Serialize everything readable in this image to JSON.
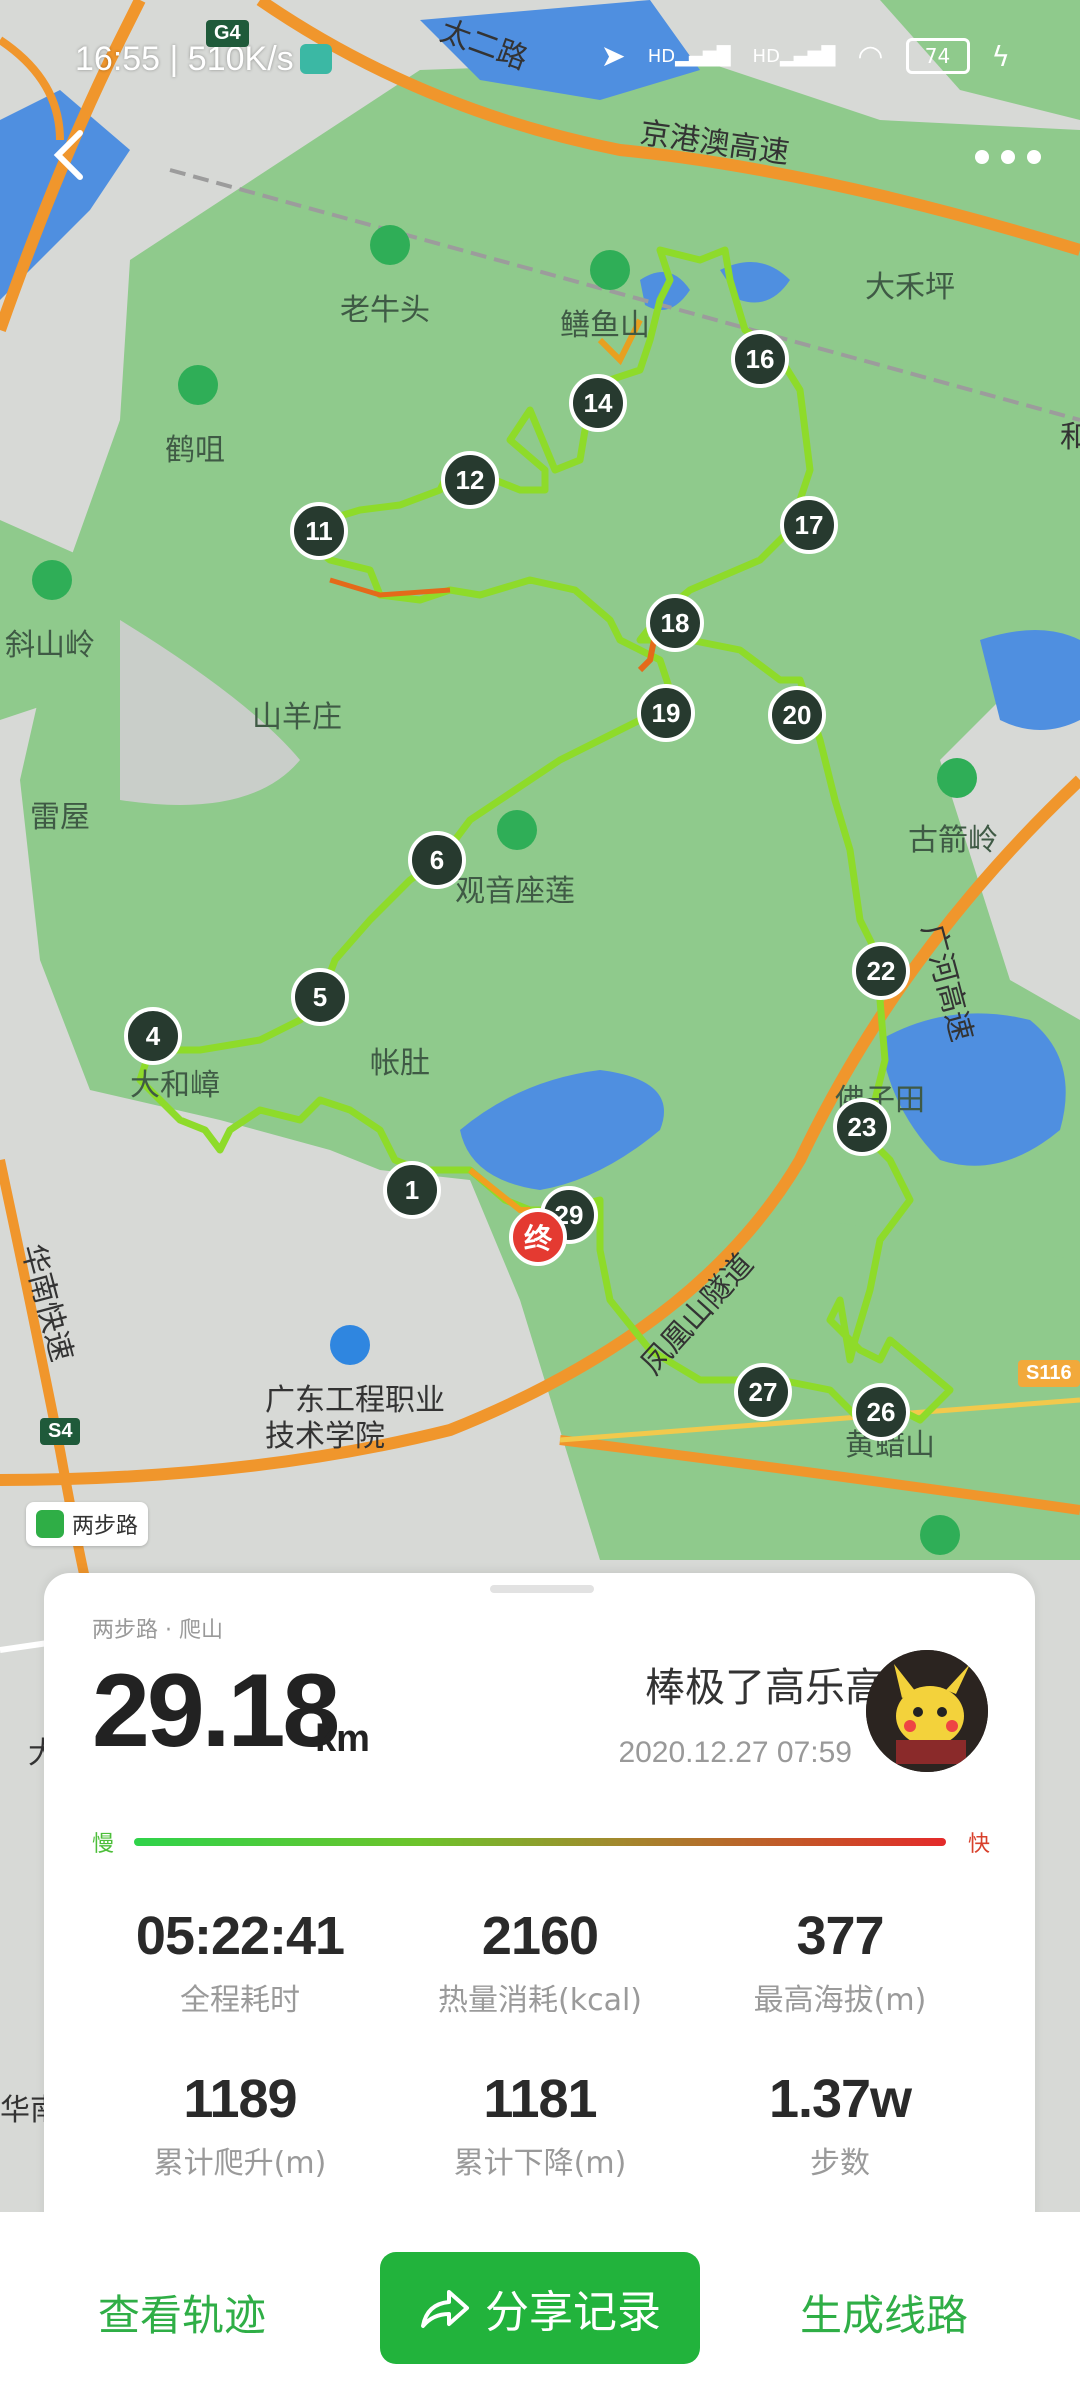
{
  "status_bar": {
    "time_speed": "16:55 | 510K/s",
    "battery": "74",
    "network_hd1": "HD",
    "network_hd2": "HD"
  },
  "top": {
    "back_icon": "chevron-left-icon",
    "more_icon": "more-dots-icon"
  },
  "map": {
    "places": [
      {
        "name": "老牛头"
      },
      {
        "name": "鳝鱼山"
      },
      {
        "name": "大禾坪"
      },
      {
        "name": "鹤咀"
      },
      {
        "name": "斜山岭"
      },
      {
        "name": "山羊庄"
      },
      {
        "name": "雷屋"
      },
      {
        "name": "观音座莲"
      },
      {
        "name": "古箭岭"
      },
      {
        "name": "帐肚"
      },
      {
        "name": "大和嶂"
      },
      {
        "name": "佛子田"
      },
      {
        "name": "广东工程职业技术学院"
      },
      {
        "name": "黄蜡山"
      }
    ],
    "roads": [
      {
        "name": "京港澳高速"
      },
      {
        "name": "凤凰山隧道"
      },
      {
        "name": "广河高速"
      },
      {
        "name": "华南快速"
      },
      {
        "name": "华南"
      },
      {
        "name": "太二路"
      },
      {
        "name": "和"
      },
      {
        "name": "大"
      }
    ],
    "shields": [
      "G4",
      "S4",
      "S116"
    ],
    "markers": [
      "1",
      "4",
      "5",
      "6",
      "11",
      "12",
      "14",
      "16",
      "17",
      "18",
      "19",
      "20",
      "22",
      "23",
      "26",
      "27",
      "29"
    ],
    "end_marker": "终",
    "watermark": "两步路"
  },
  "card": {
    "category": "两步路 · 爬山",
    "distance": "29.18",
    "distance_unit": "km",
    "username": "棒极了高乐高",
    "datetime": "2020.12.27 07:59",
    "speed_slow": "慢",
    "speed_fast": "快",
    "stats": [
      {
        "value": "05:22:41",
        "label": "全程耗时"
      },
      {
        "value": "2160",
        "label": "热量消耗(kcal)"
      },
      {
        "value": "377",
        "label": "最高海拔(m)"
      },
      {
        "value": "1189",
        "label": "累计爬升(m)"
      },
      {
        "value": "1181",
        "label": "累计下降(m)"
      },
      {
        "value": "1.37w",
        "label": "步数"
      }
    ]
  },
  "actions": {
    "view_track": "查看轨迹",
    "share": "分享记录",
    "generate_route": "生成线路"
  },
  "colors": {
    "accent": "#22b33c",
    "map_green": "#8cc98a",
    "map_gray": "#d6d8d6",
    "road_orange": "#f0962c",
    "water": "#4f8fe0"
  }
}
